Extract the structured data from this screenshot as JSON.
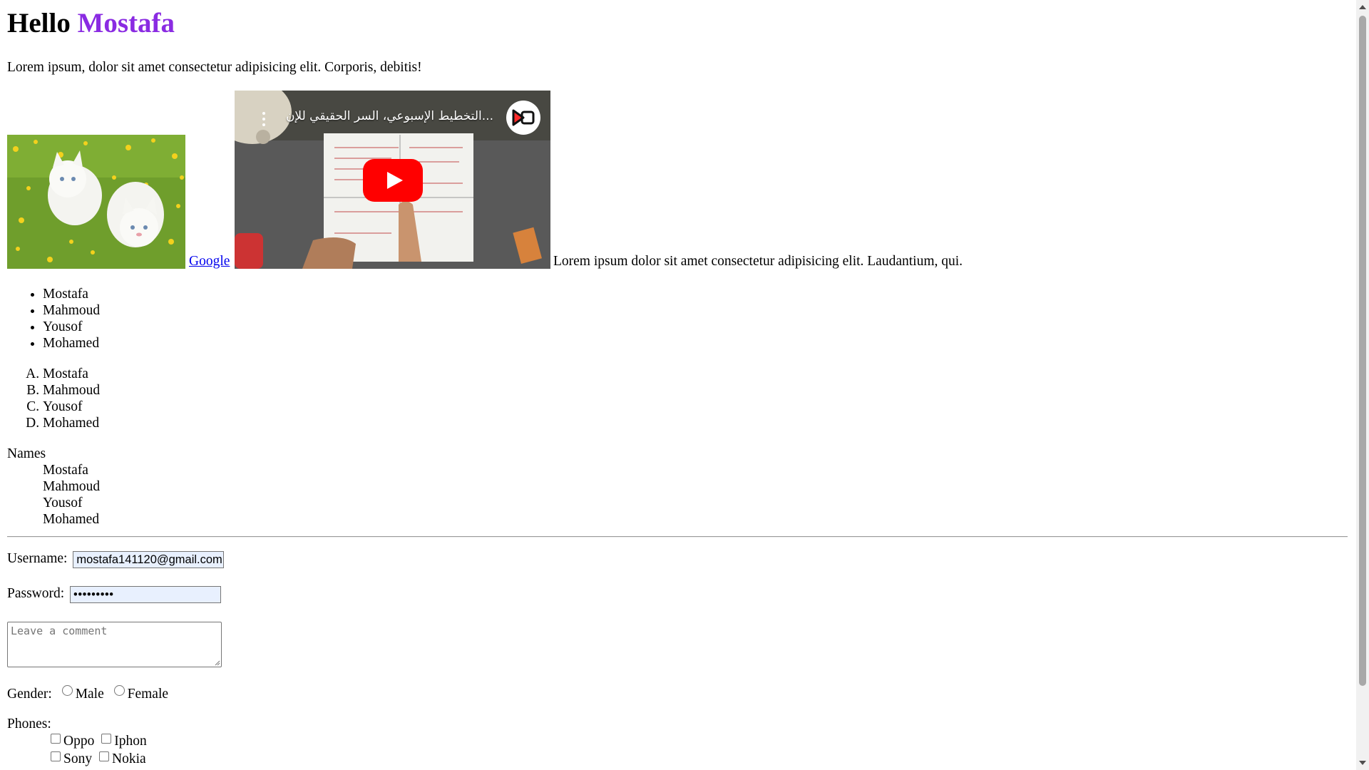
{
  "heading": {
    "greeting": "Hello",
    "name": "Mostafa"
  },
  "intro": "Lorem ipsum, dolor sit amet consectetur adipisicing elit. Corporis, debitis!",
  "media": {
    "link_label": "Google",
    "video_title": "التخطيط الإسبوعي، السر الحقيقي للإن...",
    "trailing_text": "Lorem ipsum dolor sit amet consectetur adipisicing elit. Laudantium, qui."
  },
  "unordered_list": [
    "Mostafa",
    "Mahmoud",
    "Yousof",
    "Mohamed"
  ],
  "ordered_list": [
    "Mostafa",
    "Mahmoud",
    "Yousof",
    "Mohamed"
  ],
  "description_list": {
    "title": "Names",
    "items": [
      "Mostafa",
      "Mahmoud",
      "Yousof",
      "Mohamed"
    ]
  },
  "form": {
    "username_label": "Username:",
    "username_value": "mostafa141120@gmail.com",
    "password_label": "Password:",
    "password_mask": "•••••••••",
    "comment_placeholder": "Leave a comment",
    "gender_label": "Gender:",
    "gender_options": [
      "Male",
      "Female"
    ],
    "phones_label": "Phones:",
    "phone_options": [
      "Oppo",
      "Iphon",
      "Sony",
      "Nokia"
    ]
  },
  "colors": {
    "accent": "#8a2be2",
    "link": "#0000ee",
    "youtube_red": "#ff0000"
  }
}
